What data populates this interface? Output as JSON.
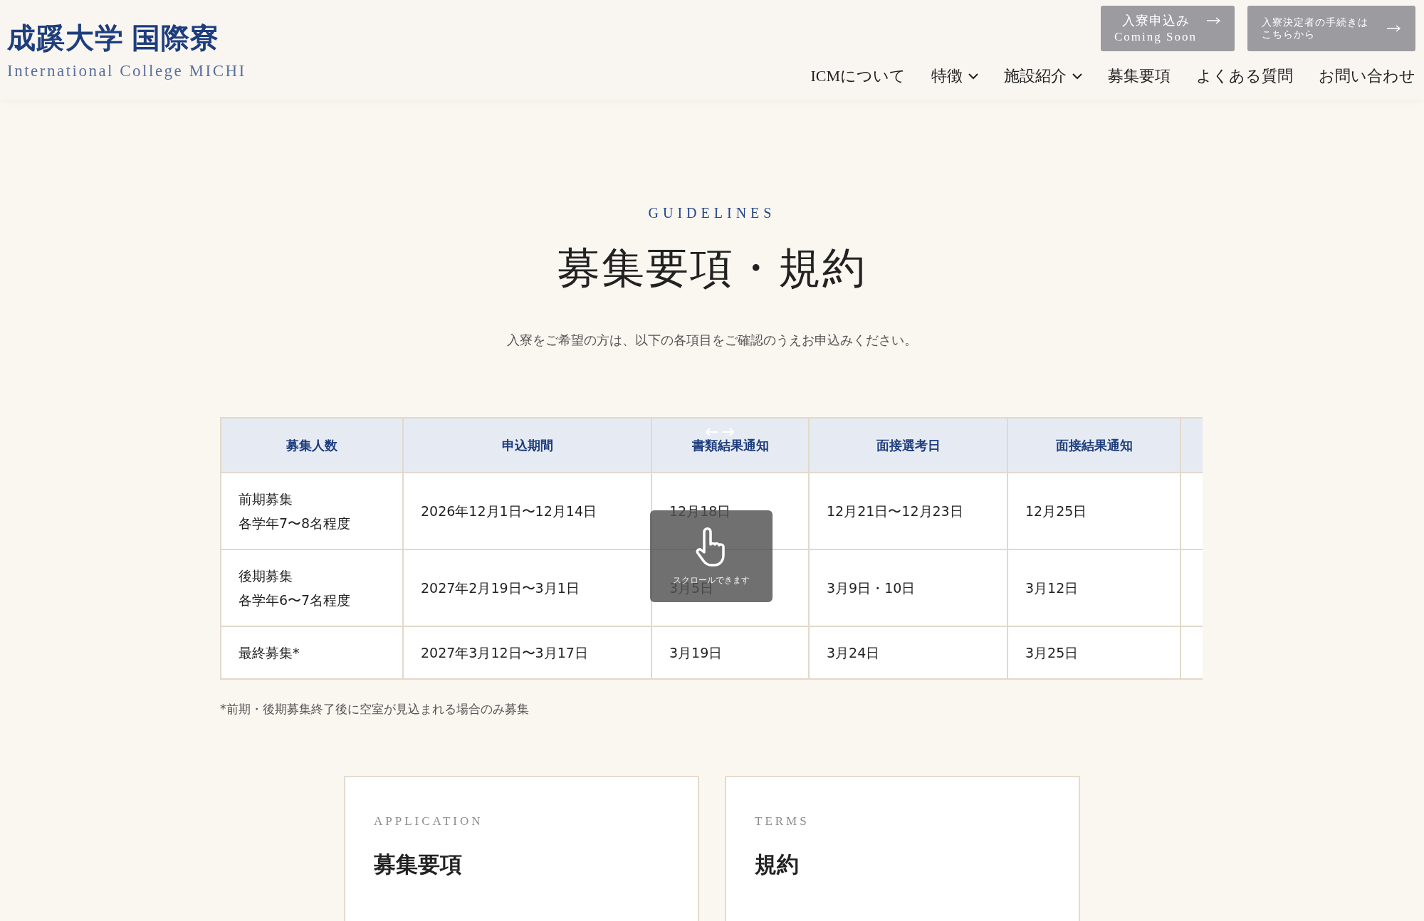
{
  "header": {
    "logo": {
      "title": "成蹊大学 国際寮",
      "subtitle": "International College MICHI"
    },
    "buttons": [
      {
        "kind": "status",
        "lines": [
          "入寮申込み",
          "Coming Soon"
        ]
      },
      {
        "kind": "link",
        "lines": [
          "入寮決定者の手続きは",
          "こちらから"
        ]
      }
    ],
    "nav": [
      {
        "label": "ICMについて",
        "has_dropdown": false
      },
      {
        "label": "特徴",
        "has_dropdown": true
      },
      {
        "label": "施設紹介",
        "has_dropdown": true
      },
      {
        "label": "募集要項",
        "has_dropdown": false
      },
      {
        "label": "よくある質問",
        "has_dropdown": false
      },
      {
        "label": "お問い合わせ",
        "has_dropdown": false
      }
    ]
  },
  "section": {
    "eyebrow": "GUIDELINES",
    "title": "募集要項・規約",
    "lead": "入寮をご希望の方は、以下の各項目をご確認のうえお申込みください。"
  },
  "table": {
    "columns": [
      "募集人数",
      "申込期間",
      "書類結果通知",
      "面接選考日",
      "面接結果通知"
    ],
    "rows": [
      [
        [
          "前期募集",
          "各学年7〜8名程度"
        ],
        "2026年12月1日〜12月14日",
        "12月18日",
        "12月21日〜12月23日",
        "12月25日"
      ],
      [
        [
          "後期募集",
          "各学年6〜7名程度"
        ],
        "2027年2月19日〜3月1日",
        "3月5日",
        "3月9日・10日",
        "3月12日"
      ],
      [
        "最終募集*",
        "2027年3月12日〜3月17日",
        "3月19日",
        "3月24日",
        "3月25日"
      ]
    ],
    "scroll_hint": {
      "text": "スクロールできます"
    }
  },
  "footnote": "*前期・後期募集終了後に空室が見込まれる場合のみ募集",
  "cards": [
    {
      "eyebrow": "APPLICATION",
      "title": "募集要項"
    },
    {
      "eyebrow": "TERMS",
      "title": "規約"
    }
  ]
}
